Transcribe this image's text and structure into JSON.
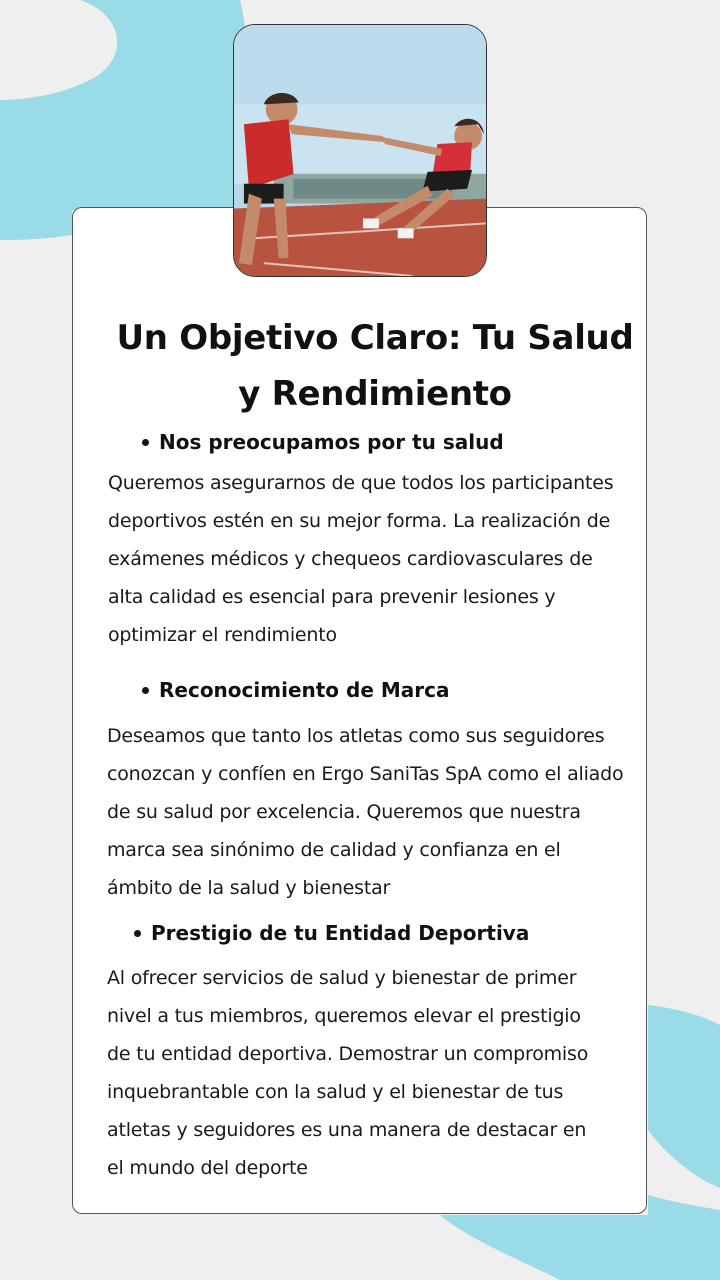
{
  "colors": {
    "background": "#efefef",
    "accent_shape": "#9adbe8",
    "card": "#ffffff"
  },
  "hero_image": "athletes-high-five-on-running-track",
  "title": "Un Objetivo Claro: Tu Salud y Rendimiento",
  "sections": [
    {
      "heading": "Nos preocupamos por tu salud",
      "body": "Queremos asegurarnos de que todos los participantes deportivos estén en su mejor forma. La realización de exámenes médicos y chequeos cardiovasculares de alta calidad es esencial para prevenir lesiones y optimizar el rendimiento"
    },
    {
      "heading": "Reconocimiento de Marca",
      "body": "Deseamos que tanto los atletas como sus seguidores conozcan y confíen en Ergo SaniTas SpA como el aliado de su salud por excelencia. Queremos que nuestra marca sea sinónimo de calidad y confianza en el ámbito de la salud y bienestar"
    },
    {
      "heading": "Prestigio de tu Entidad Deportiva",
      "body": "Al ofrecer servicios de salud y bienestar de primer nivel a tus miembros, queremos elevar el prestigio de tu entidad deportiva. Demostrar un compromiso inquebrantable con la salud y el bienestar de tus atletas y seguidores es una manera de destacar en el mundo del deporte"
    }
  ]
}
